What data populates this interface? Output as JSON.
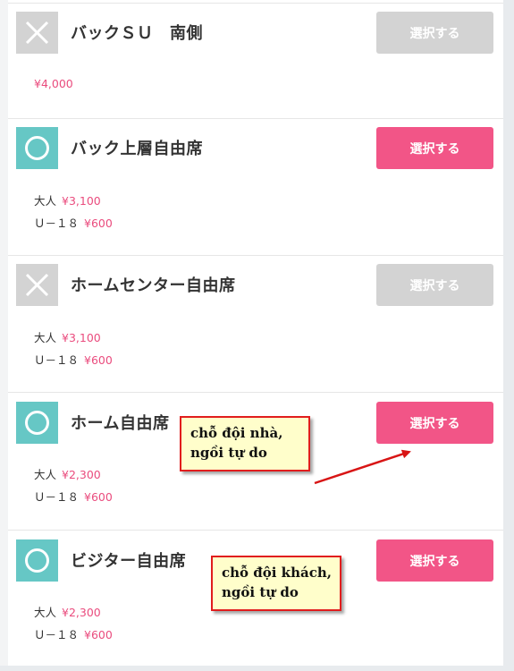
{
  "theme": {
    "available": "#66c7c5",
    "unavailable": "#d3d3d3",
    "accent": "#f25587",
    "price": "#ea4c7e"
  },
  "tickets": [
    {
      "status": "unavailable",
      "status_icon": "x-icon",
      "name": "バックＳＵ　南側",
      "button": "選択する",
      "price": "¥4,000"
    },
    {
      "status": "available",
      "status_icon": "circle-icon",
      "name": "バック上層自由席",
      "button": "選択する",
      "prices": [
        {
          "label": "大人",
          "value": "¥3,100"
        },
        {
          "label": "Ｕ－１８",
          "value": "¥600"
        }
      ]
    },
    {
      "status": "unavailable",
      "status_icon": "x-icon",
      "name": "ホームセンター自由席",
      "button": "選択する",
      "prices": [
        {
          "label": "大人",
          "value": "¥3,100"
        },
        {
          "label": "Ｕ－１８",
          "value": "¥600"
        }
      ]
    },
    {
      "status": "available",
      "status_icon": "circle-icon",
      "name": "ホーム自由席",
      "button": "選択する",
      "prices": [
        {
          "label": "大人",
          "value": "¥2,300"
        },
        {
          "label": "Ｕ－１８",
          "value": "¥600"
        }
      ]
    },
    {
      "status": "available",
      "status_icon": "circle-icon",
      "name": "ビジター自由席",
      "button": "選択する",
      "prices": [
        {
          "label": "大人",
          "value": "¥2,300"
        },
        {
          "label": "Ｕ－１８",
          "value": "¥600"
        }
      ]
    }
  ],
  "annotations": [
    {
      "lines": [
        "chỗ đội nhà,",
        "ngồi tự do"
      ]
    },
    {
      "lines": [
        "chỗ đội khách,",
        "ngồi tự do"
      ]
    }
  ]
}
